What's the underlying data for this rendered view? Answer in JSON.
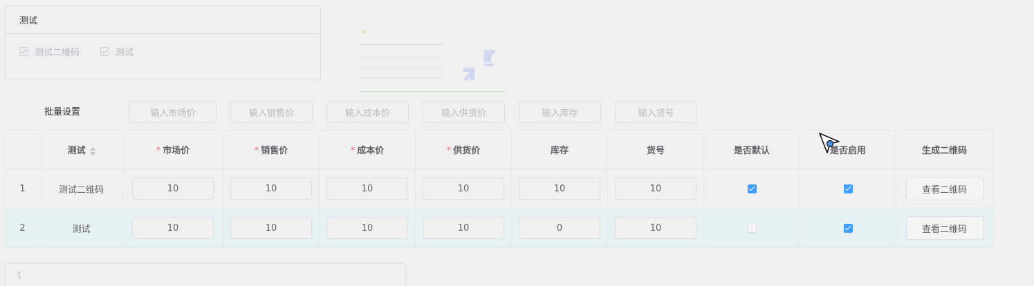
{
  "spec_panel": {
    "title": "测试",
    "options": [
      {
        "label": "测试二维码",
        "checked": true,
        "disabled": true
      },
      {
        "label": "测试",
        "checked": true,
        "disabled": true
      }
    ]
  },
  "batch": {
    "label": "批量设置",
    "placeholders": [
      "输入市场价",
      "输入销售价",
      "输入成本价",
      "输入供货价",
      "输入库存",
      "输入货号"
    ]
  },
  "table": {
    "headers": {
      "index": "",
      "spec": "测试",
      "market_price": "市场价",
      "sale_price": "销售价",
      "cost_price": "成本价",
      "supply_price": "供货价",
      "stock": "库存",
      "sku_no": "货号",
      "is_default": "是否默认",
      "is_enabled": "是否启用",
      "qr": "生成二维码"
    },
    "required_mark": "*",
    "rows": [
      {
        "index": "1",
        "spec": "测试二维码",
        "market_price": "10",
        "sale_price": "10",
        "cost_price": "10",
        "supply_price": "10",
        "stock": "10",
        "sku_no": "10",
        "is_default": true,
        "is_enabled": true,
        "qr_button": "查看二维码"
      },
      {
        "index": "2",
        "spec": "测试",
        "market_price": "10",
        "sale_price": "10",
        "cost_price": "10",
        "supply_price": "10",
        "stock": "0",
        "sku_no": "10",
        "is_default": false,
        "is_enabled": true,
        "qr_button": "查看二维码"
      }
    ]
  },
  "bottom_panel": {
    "text": "1"
  },
  "colors": {
    "accent": "#409eff",
    "required": "#f56c6c",
    "row_highlight": "#e5f1f3"
  }
}
